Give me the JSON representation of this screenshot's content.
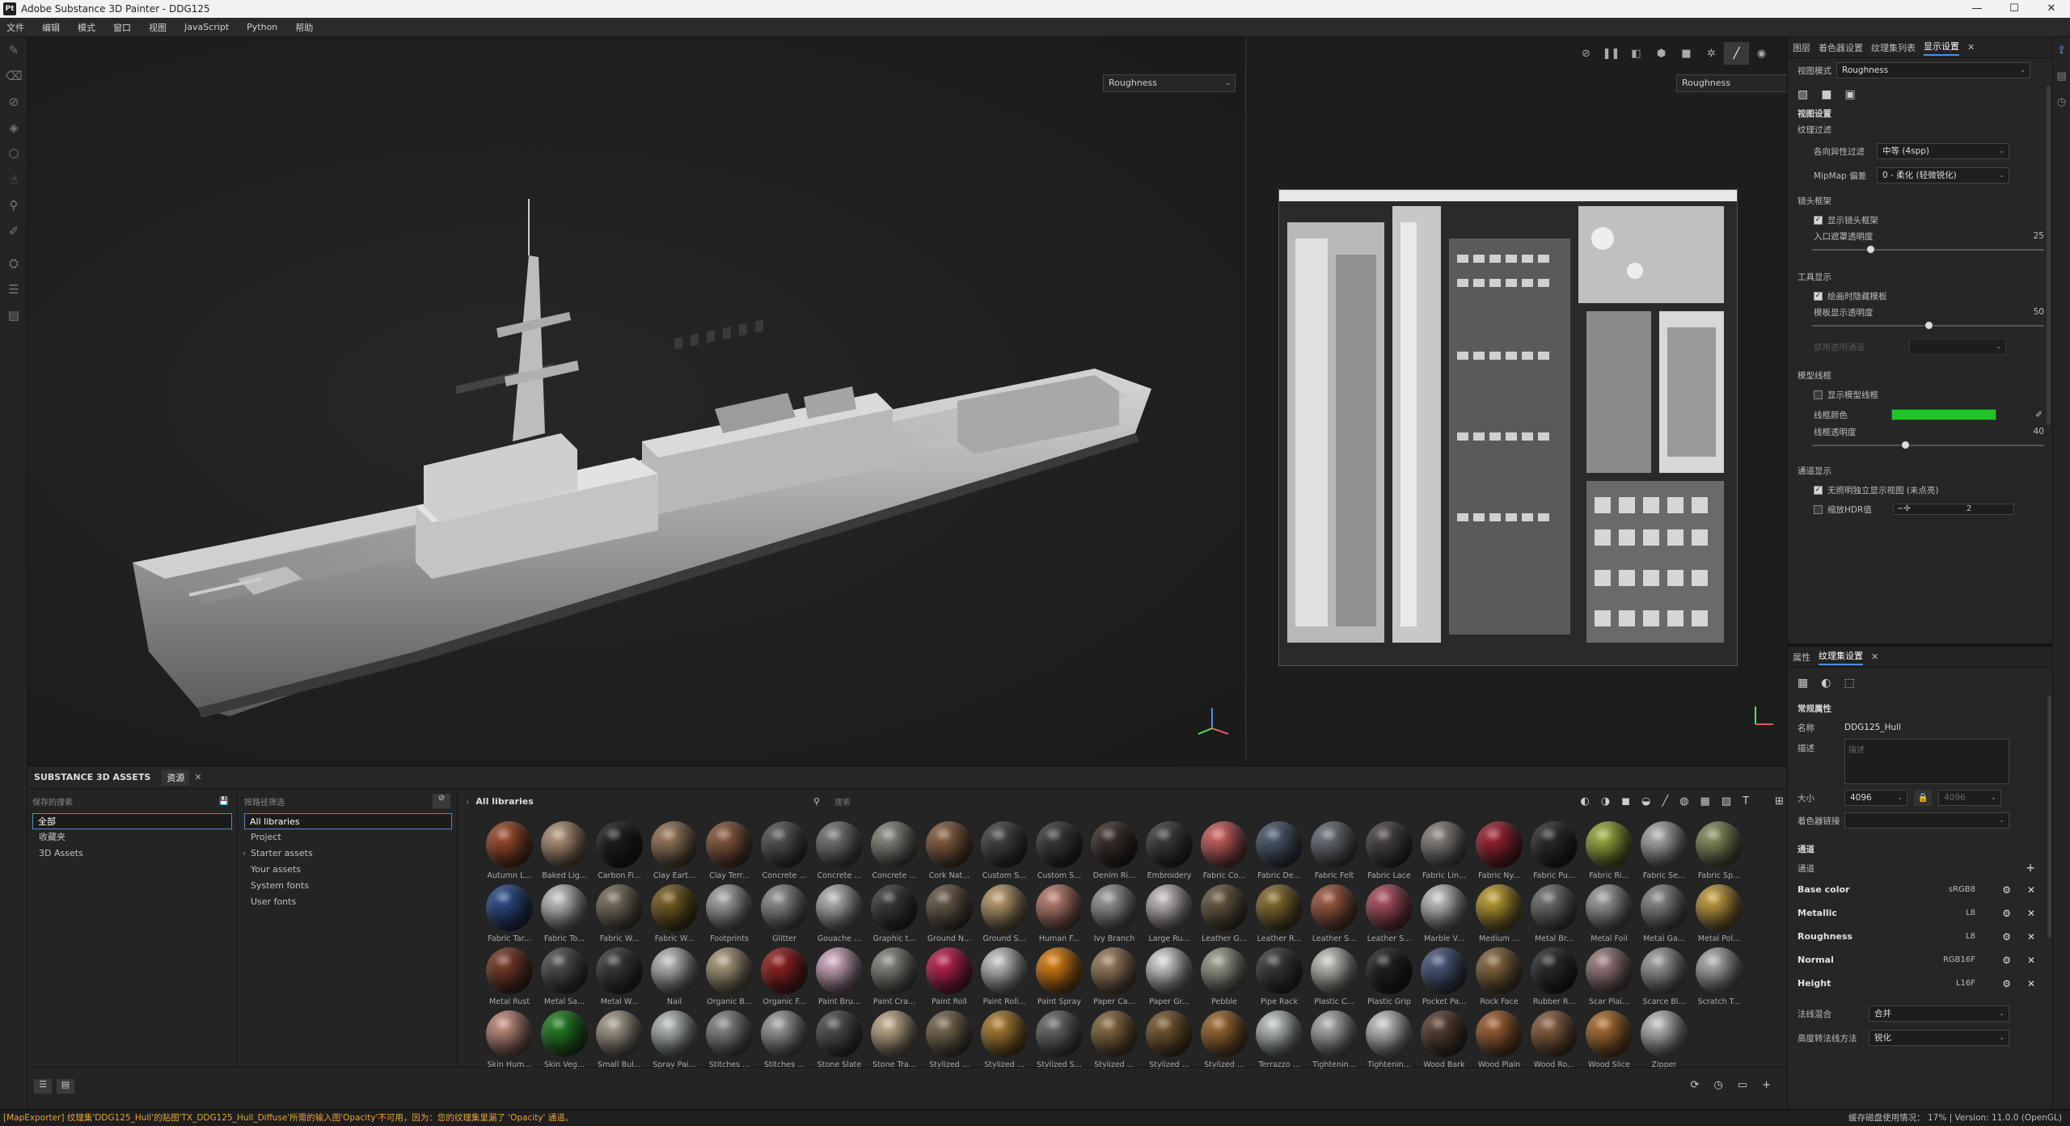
{
  "window": {
    "title": "Adobe Substance 3D Painter - DDG125",
    "logo": "Pt",
    "controls": [
      "—",
      "☐",
      "✕"
    ]
  },
  "menu": [
    "文件",
    "编辑",
    "模式",
    "窗口",
    "视图",
    "JavaScript",
    "Python",
    "帮助"
  ],
  "viewport": {
    "left_mode": "Roughness",
    "right_mode": "Roughness",
    "toolbar_icons": [
      "hide-icon",
      "pause-icon",
      "split-icon",
      "cube-icon",
      "camera-icon",
      "light-icon",
      "brush-icon",
      "screenshot-icon"
    ]
  },
  "assets": {
    "panel_title": "SUBSTANCE 3D ASSETS",
    "tab_label": "资源",
    "saved_search_label": "保存的搜索",
    "filters_label": "按路径筛选",
    "saved_searches": [
      "全部",
      "收藏夹",
      "3D Assets"
    ],
    "libraries": [
      "All libraries",
      "Project",
      "Starter assets",
      "Your assets",
      "System fonts",
      "User fonts"
    ],
    "breadcrumb": "All libraries",
    "search_placeholder": "搜索",
    "materials": [
      {
        "name": "Autumn L...",
        "color": "#a04a2a"
      },
      {
        "name": "Baked Lig...",
        "color": "#b8977a"
      },
      {
        "name": "Carbon Fi...",
        "color": "#1a1a1a"
      },
      {
        "name": "Clay Eart...",
        "color": "#9a7a5a"
      },
      {
        "name": "Clay Terr...",
        "color": "#8a5a40"
      },
      {
        "name": "Concrete ...",
        "color": "#555555"
      },
      {
        "name": "Concrete ...",
        "color": "#777777"
      },
      {
        "name": "Concrete ...",
        "color": "#8a8a80"
      },
      {
        "name": "Cork Nat...",
        "color": "#8a6040"
      },
      {
        "name": "Custom S...",
        "color": "#444444"
      },
      {
        "name": "Custom S...",
        "color": "#3a3a3a"
      },
      {
        "name": "Denim Ri...",
        "color": "#3a2e28"
      },
      {
        "name": "Embroidery",
        "color": "#3c3c3c"
      },
      {
        "name": "Fabric Co...",
        "color": "#d06060"
      },
      {
        "name": "Fabric De...",
        "color": "#4a5a70"
      },
      {
        "name": "Fabric Felt",
        "color": "#6a7078"
      },
      {
        "name": "Fabric Lace",
        "color": "#4a4446"
      },
      {
        "name": "Fabric Lin...",
        "color": "#8a8580"
      },
      {
        "name": "Fabric Ny...",
        "color": "#a02030"
      },
      {
        "name": "Fabric Pu...",
        "color": "#2a2a2a"
      },
      {
        "name": "Fabric Ri...",
        "color": "#a0b040"
      },
      {
        "name": "Fabric Se...",
        "color": "#b0b0b0"
      },
      {
        "name": "Fabric Sp...",
        "color": "#8a9060"
      },
      {
        "name": "Fabric Tar...",
        "color": "#2a4a8a"
      },
      {
        "name": "Fabric To...",
        "color": "#c8c8c8"
      },
      {
        "name": "Fabric W...",
        "color": "#7a7060"
      },
      {
        "name": "Fabric W...",
        "color": "#7a6020"
      },
      {
        "name": "Footprints",
        "color": "#a8a8a8"
      },
      {
        "name": "Glitter",
        "color": "#909090"
      },
      {
        "name": "Gouache ...",
        "color": "#b8b8b8"
      },
      {
        "name": "Graphic t...",
        "color": "#3a3a3a"
      },
      {
        "name": "Ground N...",
        "color": "#6a5a48"
      },
      {
        "name": "Ground S...",
        "color": "#c0a070"
      },
      {
        "name": "Human F...",
        "color": "#c08070"
      },
      {
        "name": "Ivy Branch",
        "color": "#9a9a9a"
      },
      {
        "name": "Large Ru...",
        "color": "#c8c0c0"
      },
      {
        "name": "Leather G...",
        "color": "#6a5a40"
      },
      {
        "name": "Leather R...",
        "color": "#8a7030"
      },
      {
        "name": "Leather S...",
        "color": "#a05a40"
      },
      {
        "name": "Leather S...",
        "color": "#b05060"
      },
      {
        "name": "Marble V...",
        "color": "#c8c8c8"
      },
      {
        "name": "Medium ...",
        "color": "#c0a030"
      },
      {
        "name": "Metal Br...",
        "color": "#707070"
      },
      {
        "name": "Metal Foil",
        "color": "#a0a0a0"
      },
      {
        "name": "Metal Ga...",
        "color": "#8a8a8a"
      },
      {
        "name": "Metal Pol...",
        "color": "#c8a040"
      },
      {
        "name": "Metal Rust",
        "color": "#7a3a28"
      },
      {
        "name": "Metal Sa...",
        "color": "#505050"
      },
      {
        "name": "Metal W...",
        "color": "#3a3a3a"
      },
      {
        "name": "Nail",
        "color": "#c0c0c0"
      },
      {
        "name": "Organic B...",
        "color": "#b0a080"
      },
      {
        "name": "Organic F...",
        "color": "#9a2020"
      },
      {
        "name": "Paint Bru...",
        "color": "#d8b0c8"
      },
      {
        "name": "Paint Cra...",
        "color": "#8a8a80"
      },
      {
        "name": "Paint Roll",
        "color": "#c02050"
      },
      {
        "name": "Paint Roll...",
        "color": "#c8c8c8"
      },
      {
        "name": "Paint Spray",
        "color": "#e08010"
      },
      {
        "name": "Paper Ca...",
        "color": "#a08060"
      },
      {
        "name": "Paper Gr...",
        "color": "#d8d8d8"
      },
      {
        "name": "Pebble",
        "color": "#a0a090"
      },
      {
        "name": "Pipe Rack",
        "color": "#3a3a3a"
      },
      {
        "name": "Plastic C...",
        "color": "#c8c8c0"
      },
      {
        "name": "Plastic Grip",
        "color": "#202020"
      },
      {
        "name": "Pocket Pa...",
        "color": "#4a5a80"
      },
      {
        "name": "Rock Face",
        "color": "#8a6a40"
      },
      {
        "name": "Rubber R...",
        "color": "#2a2a2a"
      },
      {
        "name": "Scar Plai...",
        "color": "#a08080"
      },
      {
        "name": "Scarce Bl...",
        "color": "#a0a0a0"
      },
      {
        "name": "Scratch T...",
        "color": "#b0b0b0"
      },
      {
        "name": "Skin Hum...",
        "color": "#c89080"
      },
      {
        "name": "Skin Veg...",
        "color": "#208020"
      },
      {
        "name": "Small Bul...",
        "color": "#a8a090"
      },
      {
        "name": "Spray Pai...",
        "color": "#b8c0c0"
      },
      {
        "name": "Stitches ...",
        "color": "#8a8a8a"
      },
      {
        "name": "Stitches ...",
        "color": "#a0a0a0"
      },
      {
        "name": "Stone Slate",
        "color": "#505050"
      },
      {
        "name": "Stone Tra...",
        "color": "#c8b090"
      },
      {
        "name": "Stylized ...",
        "color": "#7a6a50"
      },
      {
        "name": "Stylized ...",
        "color": "#b08030"
      },
      {
        "name": "Stylized S...",
        "color": "#6a6a6a"
      },
      {
        "name": "Stylized ...",
        "color": "#8a6a40"
      },
      {
        "name": "Stylized ...",
        "color": "#7a5a30"
      },
      {
        "name": "Stylized ...",
        "color": "#a06a30"
      },
      {
        "name": "Terrazzo ...",
        "color": "#c0c8c8"
      },
      {
        "name": "Tightenin...",
        "color": "#b0b0b0"
      },
      {
        "name": "Tightenin...",
        "color": "#c8c8c8"
      },
      {
        "name": "Wood Bark",
        "color": "#5a4030"
      },
      {
        "name": "Wood Plain",
        "color": "#a06030"
      },
      {
        "name": "Wood Ro...",
        "color": "#8a6040"
      },
      {
        "name": "Wood Slice",
        "color": "#b07030"
      },
      {
        "name": "Zipper",
        "color": "#c0c0c0"
      }
    ]
  },
  "display_settings": {
    "tabs": [
      "图层",
      "着色器设置",
      "纹理集列表",
      "显示设置"
    ],
    "active_tab": "显示设置",
    "view_mode_label": "视图模式",
    "view_mode_value": "Roughness",
    "section_view": "视图设置",
    "texture_filter": "纹理过滤",
    "aniso_label": "各向异性过滤",
    "aniso_value": "中等 (4spp)",
    "mipmap_label": "MipMap 偏差",
    "mipmap_value": "0 - 柔化 (轻微锐化)",
    "camera_frame_section": "镜头框架",
    "show_camera_frame": "显示镜头框架",
    "entry_opacity_label": "入口遮罩透明度",
    "entry_opacity_value": "25",
    "entry_opacity": 0.25,
    "tool_display": "工具显示",
    "hide_model_paint": "绘画时隐藏模板",
    "template_opacity_label": "模板显示透明度",
    "template_opacity_value": "50",
    "template_opacity": 0.5,
    "disabled_row": "禁用透明通道",
    "wireframe_section": "模型线框",
    "show_wireframe": "显示模型线框",
    "wire_color_label": "线框颜色",
    "wire_color": "#22c422",
    "wire_opacity_label": "线框透明度",
    "wire_opacity_value": "40",
    "wire_opacity": 0.4,
    "channel_display": "通道显示",
    "no_light_label": "无照明独立显示视图 (未点亮)",
    "hdr_label": "缩放HDR值",
    "hdr_value": "2"
  },
  "texture_set": {
    "tabs": [
      "属性",
      "纹理集设置"
    ],
    "active_tab": "纹理集设置",
    "section_general": "常规属性",
    "name_label": "名称",
    "name_value": "DDG125_Hull",
    "desc_label": "描述",
    "desc_placeholder": "描述",
    "size_label": "大小",
    "size_value": "4096",
    "size_value2": "4096",
    "shader_link_label": "着色器链接",
    "channels_section": "通道",
    "channels_label": "通道",
    "channels": [
      {
        "name": "Base color",
        "format": "sRGB8"
      },
      {
        "name": "Metallic",
        "format": "L8"
      },
      {
        "name": "Roughness",
        "format": "L8"
      },
      {
        "name": "Normal",
        "format": "RGB16F"
      },
      {
        "name": "Height",
        "format": "L16F"
      }
    ],
    "normal_mix_label": "法线混合",
    "normal_mix_value": "合并",
    "height_method_label": "高度转法线方法",
    "height_method_value": "锐化"
  },
  "status": {
    "warning": "[MapExporter] 纹理集'DDG125_Hull'的贴图'TX_DDG125_Hull_Diffuse'所需的输入图'Opacity'不可用，因为：您的纹理集里漏了 'Opacity' 通道。",
    "right": "缓存磁盘使用情况：  17% | Version: 11.0.0 (OpenGL)"
  },
  "colors": {
    "accent": "#4a90e2",
    "warning": "#e8a23a"
  }
}
